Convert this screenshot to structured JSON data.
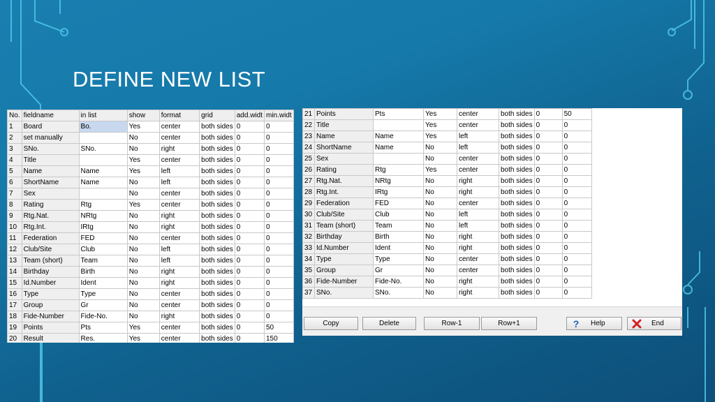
{
  "slide": {
    "title": "DEFINE NEW LIST"
  },
  "left_table": {
    "headers": [
      "No.",
      "fieldname",
      "in list",
      "show",
      "format",
      "grid",
      "add.widt",
      "min.widt"
    ],
    "rows": [
      [
        "1",
        "Board",
        "Bo.",
        "Yes",
        "center",
        "both sides",
        "0",
        "0"
      ],
      [
        "2",
        "set manually",
        "",
        "No",
        "center",
        "both sides",
        "0",
        "0"
      ],
      [
        "3",
        "SNo.",
        "SNo.",
        "No",
        "right",
        "both sides",
        "0",
        "0"
      ],
      [
        "4",
        "Title",
        "",
        "Yes",
        "center",
        "both sides",
        "0",
        "0"
      ],
      [
        "5",
        "Name",
        "Name",
        "Yes",
        "left",
        "both sides",
        "0",
        "0"
      ],
      [
        "6",
        "ShortName",
        "Name",
        "No",
        "left",
        "both sides",
        "0",
        "0"
      ],
      [
        "7",
        "Sex",
        "",
        "No",
        "center",
        "both sides",
        "0",
        "0"
      ],
      [
        "8",
        "Rating",
        "Rtg",
        "Yes",
        "center",
        "both sides",
        "0",
        "0"
      ],
      [
        "9",
        "Rtg.Nat.",
        "NRtg",
        "No",
        "right",
        "both sides",
        "0",
        "0"
      ],
      [
        "10",
        "Rtg.Int.",
        "IRtg",
        "No",
        "right",
        "both sides",
        "0",
        "0"
      ],
      [
        "11",
        "Federation",
        "FED",
        "No",
        "center",
        "both sides",
        "0",
        "0"
      ],
      [
        "12",
        "Club/Site",
        "Club",
        "No",
        "left",
        "both sides",
        "0",
        "0"
      ],
      [
        "13",
        "Team (short)",
        "Team",
        "No",
        "left",
        "both sides",
        "0",
        "0"
      ],
      [
        "14",
        "Birthday",
        "Birth",
        "No",
        "right",
        "both sides",
        "0",
        "0"
      ],
      [
        "15",
        "Id.Number",
        "Ident",
        "No",
        "right",
        "both sides",
        "0",
        "0"
      ],
      [
        "16",
        "Type",
        "Type",
        "No",
        "center",
        "both sides",
        "0",
        "0"
      ],
      [
        "17",
        "Group",
        "Gr",
        "No",
        "center",
        "both sides",
        "0",
        "0"
      ],
      [
        "18",
        "Fide-Number",
        "Fide-No.",
        "No",
        "right",
        "both sides",
        "0",
        "0"
      ],
      [
        "19",
        "Points",
        "Pts",
        "Yes",
        "center",
        "both sides",
        "0",
        "50"
      ],
      [
        "20",
        "Result",
        "Res.",
        "Yes",
        "center",
        "both sides",
        "0",
        "150"
      ]
    ]
  },
  "right_table": {
    "rows": [
      [
        "21",
        "Points",
        "Pts",
        "Yes",
        "center",
        "both sides",
        "0",
        "50"
      ],
      [
        "22",
        "Title",
        "",
        "Yes",
        "center",
        "both sides",
        "0",
        "0"
      ],
      [
        "23",
        "Name",
        "Name",
        "Yes",
        "left",
        "both sides",
        "0",
        "0"
      ],
      [
        "24",
        "ShortName",
        "Name",
        "No",
        "left",
        "both sides",
        "0",
        "0"
      ],
      [
        "25",
        "Sex",
        "",
        "No",
        "center",
        "both sides",
        "0",
        "0"
      ],
      [
        "26",
        "Rating",
        "Rtg",
        "Yes",
        "center",
        "both sides",
        "0",
        "0"
      ],
      [
        "27",
        "Rtg.Nat.",
        "NRtg",
        "No",
        "right",
        "both sides",
        "0",
        "0"
      ],
      [
        "28",
        "Rtg.Int.",
        "IRtg",
        "No",
        "right",
        "both sides",
        "0",
        "0"
      ],
      [
        "29",
        "Federation",
        "FED",
        "No",
        "center",
        "both sides",
        "0",
        "0"
      ],
      [
        "30",
        "Club/Site",
        "Club",
        "No",
        "left",
        "both sides",
        "0",
        "0"
      ],
      [
        "31",
        "Team (short)",
        "Team",
        "No",
        "left",
        "both sides",
        "0",
        "0"
      ],
      [
        "32",
        "Birthday",
        "Birth",
        "No",
        "right",
        "both sides",
        "0",
        "0"
      ],
      [
        "33",
        "Id.Number",
        "Ident",
        "No",
        "right",
        "both sides",
        "0",
        "0"
      ],
      [
        "34",
        "Type",
        "Type",
        "No",
        "center",
        "both sides",
        "0",
        "0"
      ],
      [
        "35",
        "Group",
        "Gr",
        "No",
        "center",
        "both sides",
        "0",
        "0"
      ],
      [
        "36",
        "Fide-Number",
        "Fide-No.",
        "No",
        "right",
        "both sides",
        "0",
        "0"
      ],
      [
        "37",
        "SNo.",
        "SNo.",
        "No",
        "right",
        "both sides",
        "0",
        "0"
      ]
    ]
  },
  "buttons": {
    "copy": "Copy",
    "delete": "Delete",
    "row_minus": "Row-1",
    "row_plus": "Row+1",
    "help": "Help",
    "end": "End"
  },
  "icons": {
    "help": "question-mark-icon",
    "end": "red-x-icon"
  },
  "colors": {
    "background": "#1579a9",
    "selection": "#c7d8ef",
    "end_icon": "#d22020",
    "help_icon": "#1e5fb8"
  }
}
